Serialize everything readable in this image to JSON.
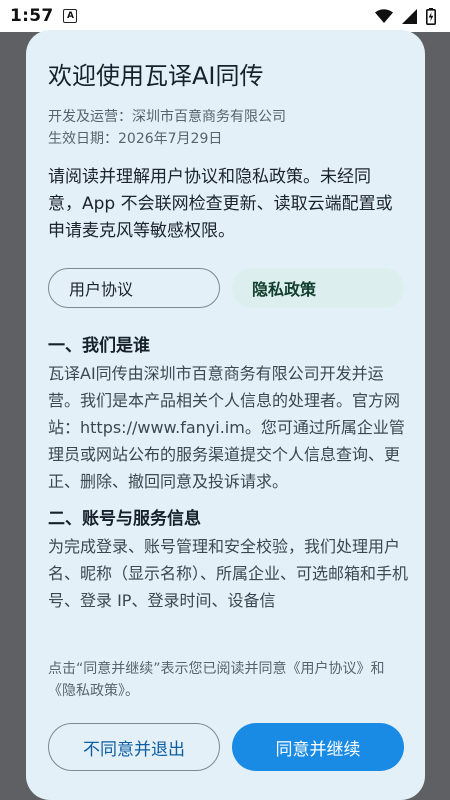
{
  "status_bar": {
    "time": "1:57",
    "notification_icon": "A",
    "icons": [
      "wifi-icon",
      "signal-icon",
      "battery-icon"
    ]
  },
  "dialog": {
    "title": "欢迎使用瓦译AI同传",
    "developer": "开发及运营：深圳市百意商务有限公司",
    "effective_date": "生效日期：2026年7月29日",
    "intro": "请阅读并理解用户协议和隐私政策。未经同意，App 不会联网检查更新、读取云端配置或申请麦克风等敏感权限。",
    "tabs": [
      {
        "label": "用户协议",
        "selected": false
      },
      {
        "label": "隐私政策",
        "selected": true
      }
    ],
    "sections": [
      {
        "title": "一、我们是谁",
        "text": "瓦译AI同传由深圳市百意商务有限公司开发并运营。我们是本产品相关个人信息的处理者。官方网站：https://www.fanyi.im。您可通过所属企业管理员或网站公布的服务渠道提交个人信息查询、更正、删除、撤回同意及投诉请求。"
      },
      {
        "title": "二、账号与服务信息",
        "text": "为完成登录、账号管理和安全校验，我们处理用户名、昵称（显示名称）、所属企业、可选邮箱和手机号、登录 IP、登录时间、设备信"
      }
    ],
    "consent_note": "点击“同意并继续”表示您已阅读并同意《用户协议》和《隐私政策》。",
    "decline_label": "不同意并退出",
    "accept_label": "同意并继续"
  },
  "colors": {
    "dialog_bg": "#e3f0f8",
    "accent": "#1a8be4",
    "scrim": "#5f6063"
  }
}
